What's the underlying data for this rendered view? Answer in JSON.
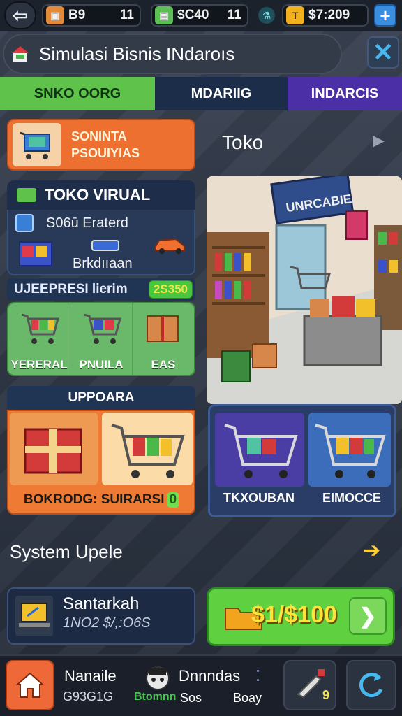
{
  "topbar": {
    "resources": [
      {
        "icon": "ticket-icon",
        "value": "B9",
        "count": "11"
      },
      {
        "icon": "cash-stack-icon",
        "value": "$C40",
        "count": "11"
      },
      {
        "icon": "gold-coin-icon",
        "value": "$7:209"
      }
    ]
  },
  "title": {
    "text": "Simulasi Bisnis INdaroıs"
  },
  "tabs": [
    {
      "label": "SNKO OORG"
    },
    {
      "label": "MDARIIG"
    },
    {
      "label": "INDARCIS"
    }
  ],
  "sort_panel": {
    "line1": "SONINTA",
    "line2": "PSOUIYIAS"
  },
  "store_panel": {
    "title": "TOKO VIRUAL",
    "row1": "S06ū Eraterd",
    "row2": "Brkdııaan"
  },
  "delivery": {
    "title": "UJEEPRESI lierim",
    "badge": "2S350"
  },
  "categories": [
    {
      "label": "YERERAL"
    },
    {
      "label": "PNUILA"
    },
    {
      "label": "EAS"
    }
  ],
  "upgrade": {
    "header": "UPPOARA",
    "label": "BOKRODG: SUIRARSI",
    "green": "0"
  },
  "toko": {
    "title": "Toko",
    "sign": "UNRCABIE"
  },
  "actions": [
    {
      "label": "TKXOUBAN"
    },
    {
      "label": "EIMOCCE"
    }
  ],
  "system": {
    "label": "System Upele"
  },
  "info_card": {
    "name": "Santarkah",
    "sub": "1NO2 $/,:O6S"
  },
  "cash_button": {
    "value": "$1/$100"
  },
  "bottombar": {
    "name": "Nanaile",
    "number": "G93G1G",
    "name2": "Dnnndas",
    "sub": "Btomnn",
    "seo": "Sos",
    "pony": "Boay",
    "tool_badge": "9"
  }
}
